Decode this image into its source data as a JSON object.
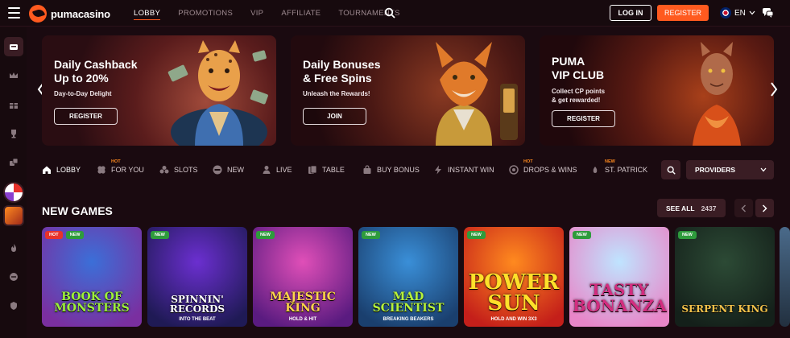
{
  "header": {
    "logo_text": "pumacasino",
    "nav": [
      {
        "label": "LOBBY",
        "active": true
      },
      {
        "label": "PROMOTIONS",
        "active": false
      },
      {
        "label": "VIP",
        "active": false
      },
      {
        "label": "AFFILIATE",
        "active": false
      },
      {
        "label": "TOURNAMENTS",
        "active": false
      }
    ],
    "login_label": "LOG IN",
    "register_label": "REGISTER",
    "language": "EN"
  },
  "sidebar": {
    "items": [
      "casino-icon",
      "crown-icon",
      "gift-icon",
      "trophy-icon",
      "dice-icon",
      "wheel-game",
      "game-thumb",
      "fire-icon",
      "chat-bubble-icon",
      "shield-icon"
    ]
  },
  "banners": [
    {
      "title": "Daily Cashback\nUp to 20%",
      "subtitle": "Day-to-Day Delight",
      "button": "REGISTER"
    },
    {
      "title": "Daily Bonuses\n& Free Spins",
      "subtitle": "Unleash the Rewards!",
      "button": "JOIN"
    },
    {
      "title": "PUMA\nVIP CLUB",
      "subtitle": "Collect CP points\n& get rewarded!",
      "button": "REGISTER"
    }
  ],
  "categories": [
    {
      "label": "LOBBY",
      "tag": "",
      "icon": "home-icon",
      "active": true
    },
    {
      "label": "FOR YOU",
      "tag": "HOT",
      "icon": "clover-icon",
      "active": false
    },
    {
      "label": "SLOTS",
      "tag": "",
      "icon": "slots-icon",
      "active": false
    },
    {
      "label": "NEW",
      "tag": "",
      "icon": "new-icon",
      "active": false
    },
    {
      "label": "LIVE",
      "tag": "",
      "icon": "dealer-icon",
      "active": false
    },
    {
      "label": "TABLE",
      "tag": "",
      "icon": "cards-icon",
      "active": false
    },
    {
      "label": "BUY BONUS",
      "tag": "",
      "icon": "bag-icon",
      "active": false
    },
    {
      "label": "INSTANT WIN",
      "tag": "",
      "icon": "bolt-icon",
      "active": false
    },
    {
      "label": "DROPS & WINS",
      "tag": "HOT",
      "icon": "drops-icon",
      "active": false
    },
    {
      "label": "ST. PATRICK",
      "tag": "NEW",
      "icon": "shamrock-icon",
      "active": false
    }
  ],
  "providers_label": "PROVIDERS",
  "new_games": {
    "title": "NEW GAMES",
    "see_all_label": "SEE ALL",
    "count": "2437",
    "games": [
      {
        "title": "BOOK OF\nMONSTERS",
        "subtitle": "",
        "badges": [
          "HOT",
          "NEW"
        ],
        "bg1": "#3b6fd8",
        "bg2": "#7a2fa0",
        "text_color": "#9cf03a"
      },
      {
        "title": "SPINNIN'\nRECORDS",
        "subtitle": "INTO THE BEAT",
        "badges": [
          "NEW"
        ],
        "bg1": "#6b2fd0",
        "bg2": "#1f1a55",
        "text_color": "#ffffff"
      },
      {
        "title": "MAJESTIC KING",
        "subtitle": "HOLD & HIT",
        "badges": [
          "NEW"
        ],
        "bg1": "#e04fb8",
        "bg2": "#5a1b80",
        "text_color": "#ffd54a"
      },
      {
        "title": "MAD\nSCIENTIST",
        "subtitle": "BREAKING BEAKERS",
        "badges": [
          "NEW"
        ],
        "bg1": "#3a8fd8",
        "bg2": "#1a3f6e",
        "text_color": "#b6f23a"
      },
      {
        "title": "POWER\nSUN",
        "subtitle": "HOLD AND WIN 3X3",
        "badges": [
          "NEW"
        ],
        "bg1": "#ff8a1f",
        "bg2": "#c41f1a",
        "text_color": "#ffe02a"
      },
      {
        "title": "TASTY\nBONANZA",
        "subtitle": "",
        "badges": [
          "NEW"
        ],
        "bg1": "#bfe4ff",
        "bg2": "#e886c8",
        "text_color": "#d22d7f"
      },
      {
        "title": "SERPENT KING",
        "subtitle": "",
        "badges": [
          "NEW"
        ],
        "bg1": "#2c4a35",
        "bg2": "#14201a",
        "text_color": "#f2c14a"
      }
    ]
  },
  "colors": {
    "accent": "#ff5a1f",
    "background": "#1a0a10",
    "panel": "#3a1d24"
  }
}
